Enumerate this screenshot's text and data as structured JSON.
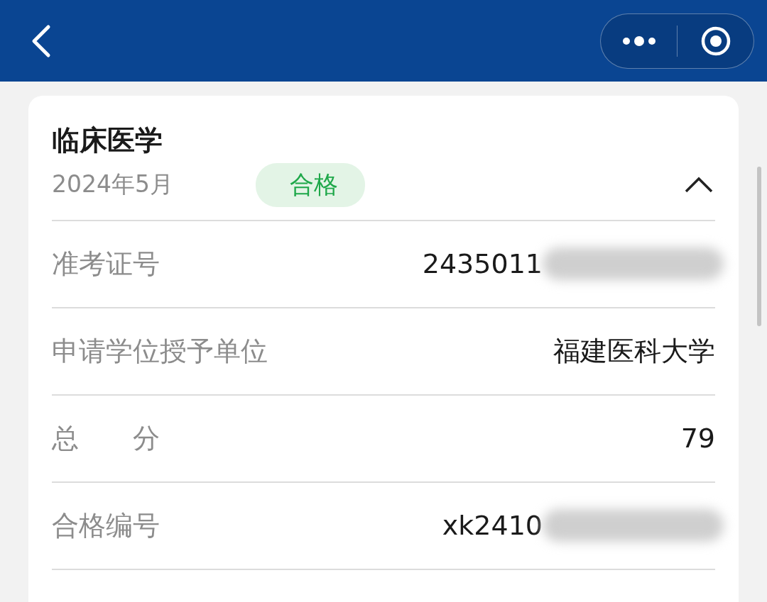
{
  "card": {
    "title": "临床医学",
    "date": "2024年5月",
    "status": "合格",
    "expanded": true,
    "rows": [
      {
        "label": "准考证号",
        "value": "2435011",
        "redacted": true
      },
      {
        "label": "申请学位授予单位",
        "value": "福建医科大学",
        "redacted": false
      },
      {
        "label": "总　　分",
        "value": "79",
        "redacted": false
      },
      {
        "label": "合格编号",
        "value": "xk2410",
        "redacted": true
      }
    ]
  }
}
